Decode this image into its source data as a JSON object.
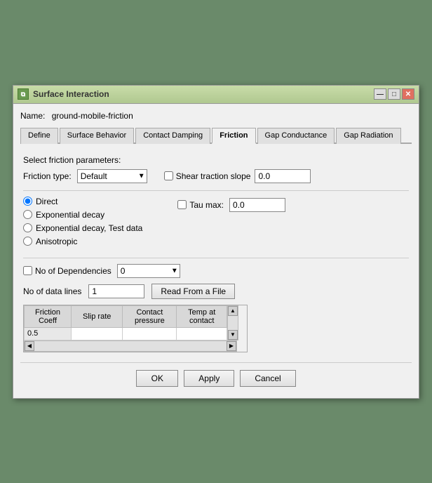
{
  "window": {
    "title": "Surface Interaction",
    "icon_label": "SI"
  },
  "title_buttons": {
    "minimize": "—",
    "maximize": "□",
    "close": "✕"
  },
  "name_row": {
    "label": "Name:",
    "value": "ground-mobile-friction"
  },
  "tabs": [
    {
      "id": "define",
      "label": "Define",
      "active": false
    },
    {
      "id": "surface-behavior",
      "label": "Surface Behavior",
      "active": false
    },
    {
      "id": "contact-damping",
      "label": "Contact Damping",
      "active": false
    },
    {
      "id": "friction",
      "label": "Friction",
      "active": true
    },
    {
      "id": "gap-conductance",
      "label": "Gap Conductance",
      "active": false
    },
    {
      "id": "gap-radiation",
      "label": "Gap Radiation",
      "active": false
    }
  ],
  "content": {
    "select_label": "Select friction parameters:",
    "friction_type_label": "Friction type:",
    "friction_type_value": "Default",
    "shear_traction_label": "Shear traction slope",
    "shear_traction_value": "0.0",
    "tau_max_label": "Tau max:",
    "tau_max_value": "0.0",
    "radio_options": [
      {
        "id": "direct",
        "label": "Direct",
        "checked": true
      },
      {
        "id": "exp-decay",
        "label": "Exponential decay",
        "checked": false
      },
      {
        "id": "exp-decay-test",
        "label": "Exponential decay, Test data",
        "checked": false
      },
      {
        "id": "anisotropic",
        "label": "Anisotropic",
        "checked": false
      }
    ],
    "no_deps_label": "No of Dependencies",
    "no_deps_value": "0",
    "data_lines_label": "No of data lines",
    "data_lines_value": "1",
    "read_file_btn": "Read From a File",
    "table": {
      "headers": [
        "Friction\nCoeff",
        "Slip rate",
        "Contact\npressure",
        "Temp at\ncontact"
      ],
      "rows": [
        [
          "0.5",
          "",
          "",
          ""
        ]
      ]
    }
  },
  "footer": {
    "ok": "OK",
    "apply": "Apply",
    "cancel": "Cancel"
  }
}
